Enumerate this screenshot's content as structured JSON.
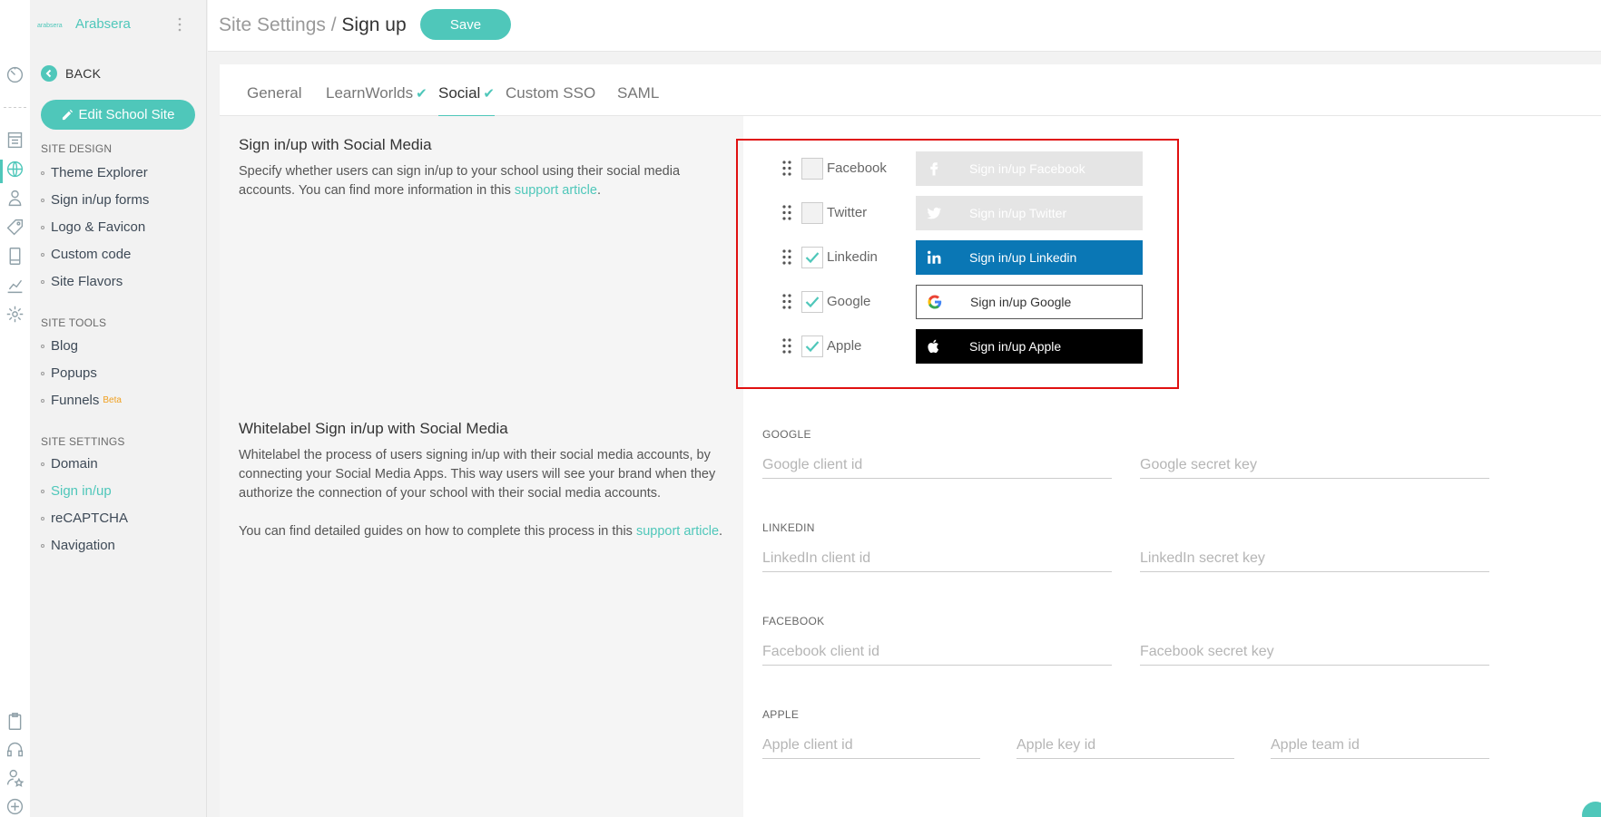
{
  "brand": {
    "name": "Arabsera",
    "logo_text": "arabsera"
  },
  "sidebar": {
    "back_label": "BACK",
    "edit_label": "Edit School Site",
    "sections": [
      {
        "heading": "SITE DESIGN",
        "items": [
          "Theme Explorer",
          "Sign in/up forms",
          "Logo & Favicon",
          "Custom code",
          "Site Flavors"
        ]
      },
      {
        "heading": "SITE TOOLS",
        "items": [
          "Blog",
          "Popups",
          "Funnels"
        ]
      },
      {
        "heading": "SITE SETTINGS",
        "items": [
          "Domain",
          "Sign in/up",
          "reCAPTCHA",
          "Navigation"
        ]
      }
    ],
    "beta_label": "Beta",
    "active_item": "Sign in/up"
  },
  "header": {
    "crumb_parent": "Site Settings /",
    "crumb_current": "Sign up",
    "save_label": "Save"
  },
  "tabs": [
    {
      "label": "General",
      "checked": false,
      "active": false
    },
    {
      "label": "LearnWorlds",
      "checked": true,
      "active": false
    },
    {
      "label": "Social",
      "checked": true,
      "active": true
    },
    {
      "label": "Custom SSO",
      "checked": false,
      "active": false
    },
    {
      "label": "SAML",
      "checked": false,
      "active": false
    }
  ],
  "social_section": {
    "title": "Sign in/up with Social Media",
    "desc_prefix": "Specify whether users can sign in/up to your school using their social media accounts. You can find more information in this ",
    "link_text": "support article",
    "desc_suffix": "."
  },
  "providers": [
    {
      "name": "Facebook",
      "checked": false,
      "button_label": "Sign in/up Facebook",
      "icon": "facebook-icon"
    },
    {
      "name": "Twitter",
      "checked": false,
      "button_label": "Sign in/up Twitter",
      "icon": "twitter-icon"
    },
    {
      "name": "Linkedin",
      "checked": true,
      "button_label": "Sign in/up Linkedin",
      "icon": "linkedin-icon"
    },
    {
      "name": "Google",
      "checked": true,
      "button_label": "Sign in/up Google",
      "icon": "google-icon"
    },
    {
      "name": "Apple",
      "checked": true,
      "button_label": "Sign in/up Apple",
      "icon": "apple-icon"
    }
  ],
  "whitelabel_section": {
    "title": "Whitelabel Sign in/up with Social Media",
    "desc1": "Whitelabel the process of users signing in/up with their social media accounts, by connecting your Social Media Apps. This way users will see your brand when they authorize the connection of your school with their social media accounts.",
    "desc2_prefix": "You can find detailed guides on how to complete this process in this ",
    "link_text": "support article",
    "desc2_suffix": "."
  },
  "whitelabel_groups": [
    {
      "heading": "GOOGLE",
      "fields": [
        {
          "placeholder": "Google client id",
          "value": ""
        },
        {
          "placeholder": "Google secret key",
          "value": ""
        }
      ]
    },
    {
      "heading": "LINKEDIN",
      "fields": [
        {
          "placeholder": "LinkedIn client id",
          "value": ""
        },
        {
          "placeholder": "LinkedIn secret key",
          "value": ""
        }
      ]
    },
    {
      "heading": "FACEBOOK",
      "fields": [
        {
          "placeholder": "Facebook client id",
          "value": ""
        },
        {
          "placeholder": "Facebook secret key",
          "value": ""
        }
      ]
    },
    {
      "heading": "APPLE",
      "fields": [
        {
          "placeholder": "Apple client id",
          "value": ""
        },
        {
          "placeholder": "Apple key id",
          "value": ""
        },
        {
          "placeholder": "Apple team id",
          "value": ""
        }
      ]
    }
  ],
  "colors": {
    "accent": "#4fc7ba",
    "linkedin": "#0a77b5",
    "apple": "#000000",
    "highlight": "#e01010"
  }
}
